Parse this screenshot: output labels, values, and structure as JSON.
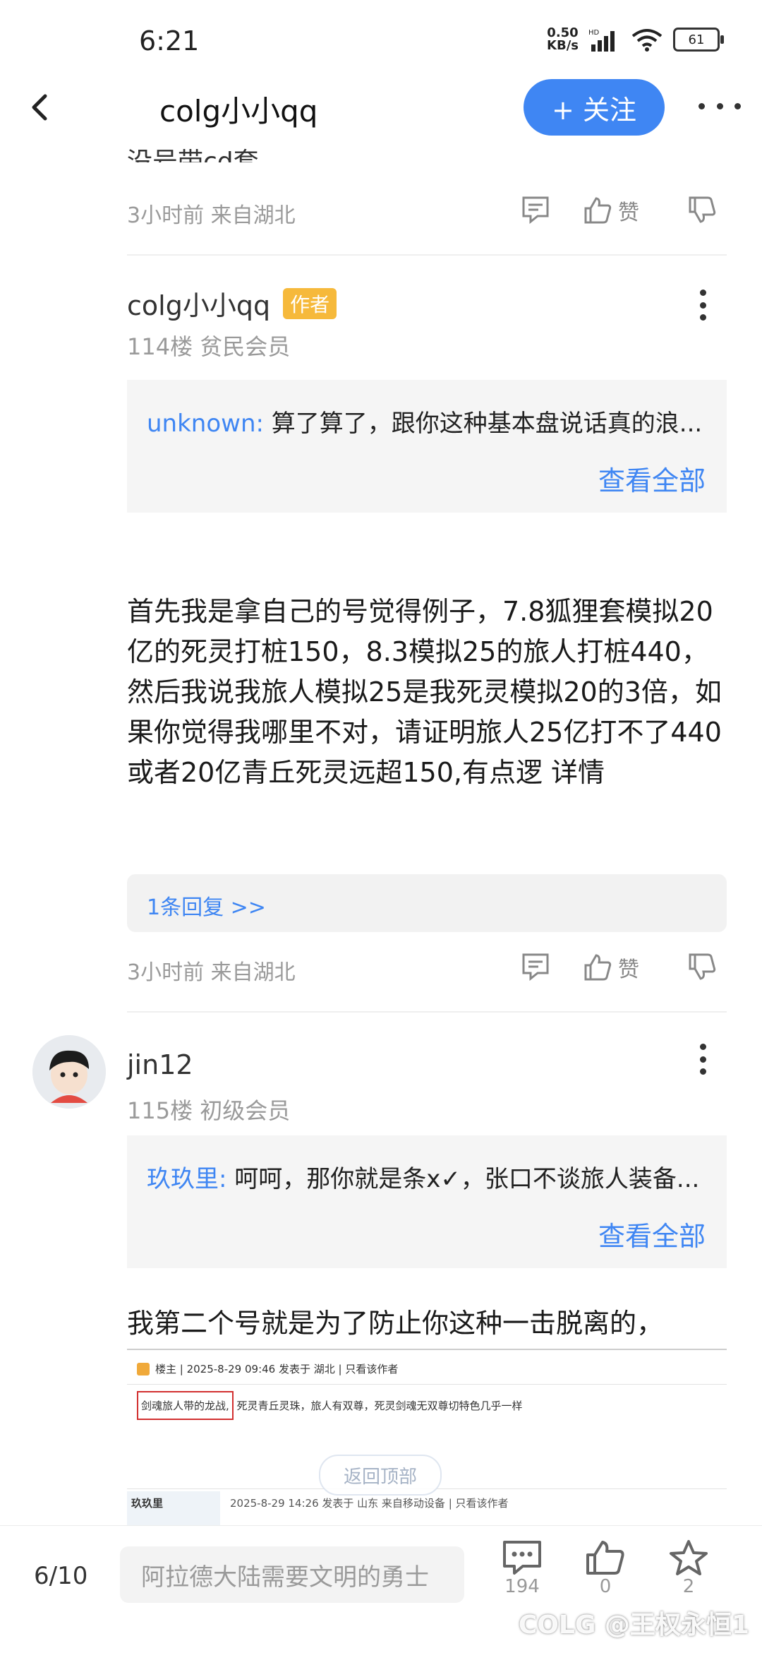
{
  "status": {
    "time": "6:21",
    "net_speed_top": "0.50",
    "net_speed_unit": "KB/s",
    "signal": "HD",
    "battery": "61"
  },
  "nav": {
    "title": "colg小小qq",
    "follow_label": "+ 关注"
  },
  "prev_post": {
    "clipped_text": "没号带cd套",
    "meta": "3小时前 来自湖北",
    "like_label": "赞"
  },
  "post1": {
    "username": "colg小小qq",
    "badge": "作者",
    "floor": "114楼 贫民会员",
    "quote_user": "unknown:",
    "quote_text": " 算了算了，跟你这种基本盘说话真的浪...",
    "see_all": "查看全部",
    "body": "首先我是拿自己的号觉得例子，7.8狐狸套模拟20亿的死灵打桩150，8.3模拟25的旅人打桩440，然后我说我旅人模拟25是我死灵模拟20的3倍，如果你觉得我哪里不对，请证明旅人25亿打不了440或者20亿青丘死灵远超150,有点逻  详情",
    "replies": "1条回复 >>",
    "meta": "3小时前 来自湖北",
    "like_label": "赞"
  },
  "post2": {
    "username": "jin12",
    "floor": "115楼 初级会员",
    "quote_user": "玖玖里:",
    "quote_text": " 呵呵，那你就是条x✓，张口不谈旅人装备...",
    "see_all": "查看全部",
    "body": "我第二个号就是为了防止你这种一击脱离的，"
  },
  "embedded": {
    "row1_meta": "楼主 | 2025-8-29 09:46 发表于 湖北 | 只看该作者",
    "row1_highlight": "剑魂旅人带的龙战,",
    "row1_text": " 死灵青丘灵珠，旅人有双尊，死灵剑魂无双尊切特色几乎一样",
    "row2_user": "玖玖里",
    "row2_meta": "2025-8-29 14:26 发表于 山东 来自移动设备 | 只看该作者"
  },
  "back_to_top": "返回顶部",
  "bottom": {
    "page": "6/10",
    "input_placeholder": "阿拉德大陆需要文明的勇士",
    "comments": "194",
    "likes": "0",
    "stars": "2"
  },
  "watermark": "COLG @王权永恒1"
}
